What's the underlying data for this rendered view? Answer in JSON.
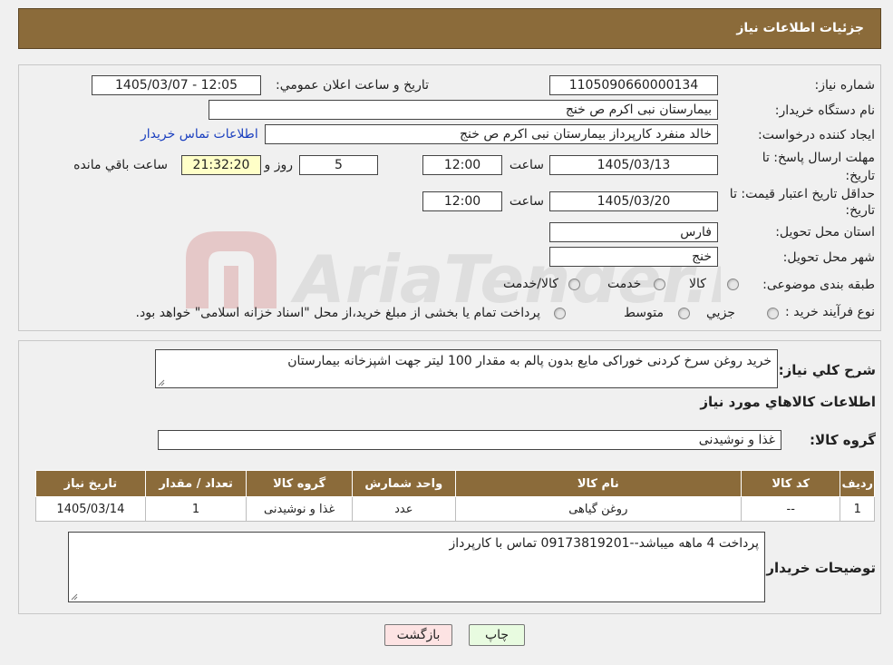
{
  "header": {
    "title": "جزئیات اطلاعات نیاز"
  },
  "watermark": {
    "text": "AriaTender.neT"
  },
  "form": {
    "need_number_label": "شماره نیاز:",
    "need_number": "1105090660000134",
    "announce_label": "تاريخ و ساعت اعلان عمومي:",
    "announce_value": "1405/03/07 - 12:05",
    "buyer_org_label": "نام دستگاه خريدار:",
    "buyer_org": "بیمارستان نبی اکرم  ص  خنج",
    "requester_label": "ايجاد كننده درخواست:",
    "requester": "خالد منفرد کارپرداز بیمارستان نبی اکرم  ص  خنج",
    "contact_link": "اطلاعات تماس خريدار",
    "deadline_label": "مهلت ارسال پاسخ: تا تاريخ:",
    "deadline_date": "1405/03/13",
    "time_label": "ساعت",
    "deadline_time": "12:00",
    "days_value": "5",
    "days_label": "روز و",
    "remaining_time": "21:32:20",
    "remaining_label": "ساعت باقي مانده",
    "price_valid_label": "حداقل تاريخ اعتبار قيمت: تا تاريخ:",
    "price_valid_date": "1405/03/20",
    "price_valid_time": "12:00",
    "province_label": "استان محل تحويل:",
    "province": "فارس",
    "city_label": "شهر محل تحويل:",
    "city": "خنج",
    "category_label": "طبقه بندی موضوعی:",
    "category_options": [
      "کالا",
      "خدمت",
      "کالا/خدمت"
    ],
    "process_label": "نوع فرآيند خريد :",
    "process_options": [
      "جزيي",
      "متوسط"
    ],
    "process_note": "پرداخت تمام يا بخشی از مبلغ خريد،از محل \"اسناد خزانه اسلامی\" خواهد بود."
  },
  "details": {
    "summary_label": "شرح كلي نياز:",
    "summary": "خرید روغن سرخ کردنی خوراکی  مایع  بدون پالم به مقدار 100 لیتر جهت اشپزخانه بیمارستان",
    "goods_info_title": "اطلاعات كالاهاي مورد نياز",
    "goods_group_label": "گروه كالا:",
    "goods_group": "غذا و نوشیدنی",
    "table": {
      "headers": [
        "رديف",
        "كد كالا",
        "نام كالا",
        "واحد شمارش",
        "گروه كالا",
        "تعداد / مقدار",
        "تاريخ نياز"
      ],
      "rows": [
        [
          "1",
          "--",
          "روغن گیاهی",
          "عدد",
          "غذا و نوشیدنی",
          "1",
          "1405/03/14"
        ]
      ]
    },
    "buyer_notes_label": "توضيحات خريدار:",
    "buyer_notes": "پرداخت 4 ماهه میباشد--09173819201 تماس با کارپرداز"
  },
  "buttons": {
    "print": "چاپ",
    "back": "بازگشت"
  },
  "colors": {
    "header_bg": "#8b6b3a",
    "back_button_bg": "#fde3e3",
    "print_button_bg": "#e8fbe0"
  }
}
